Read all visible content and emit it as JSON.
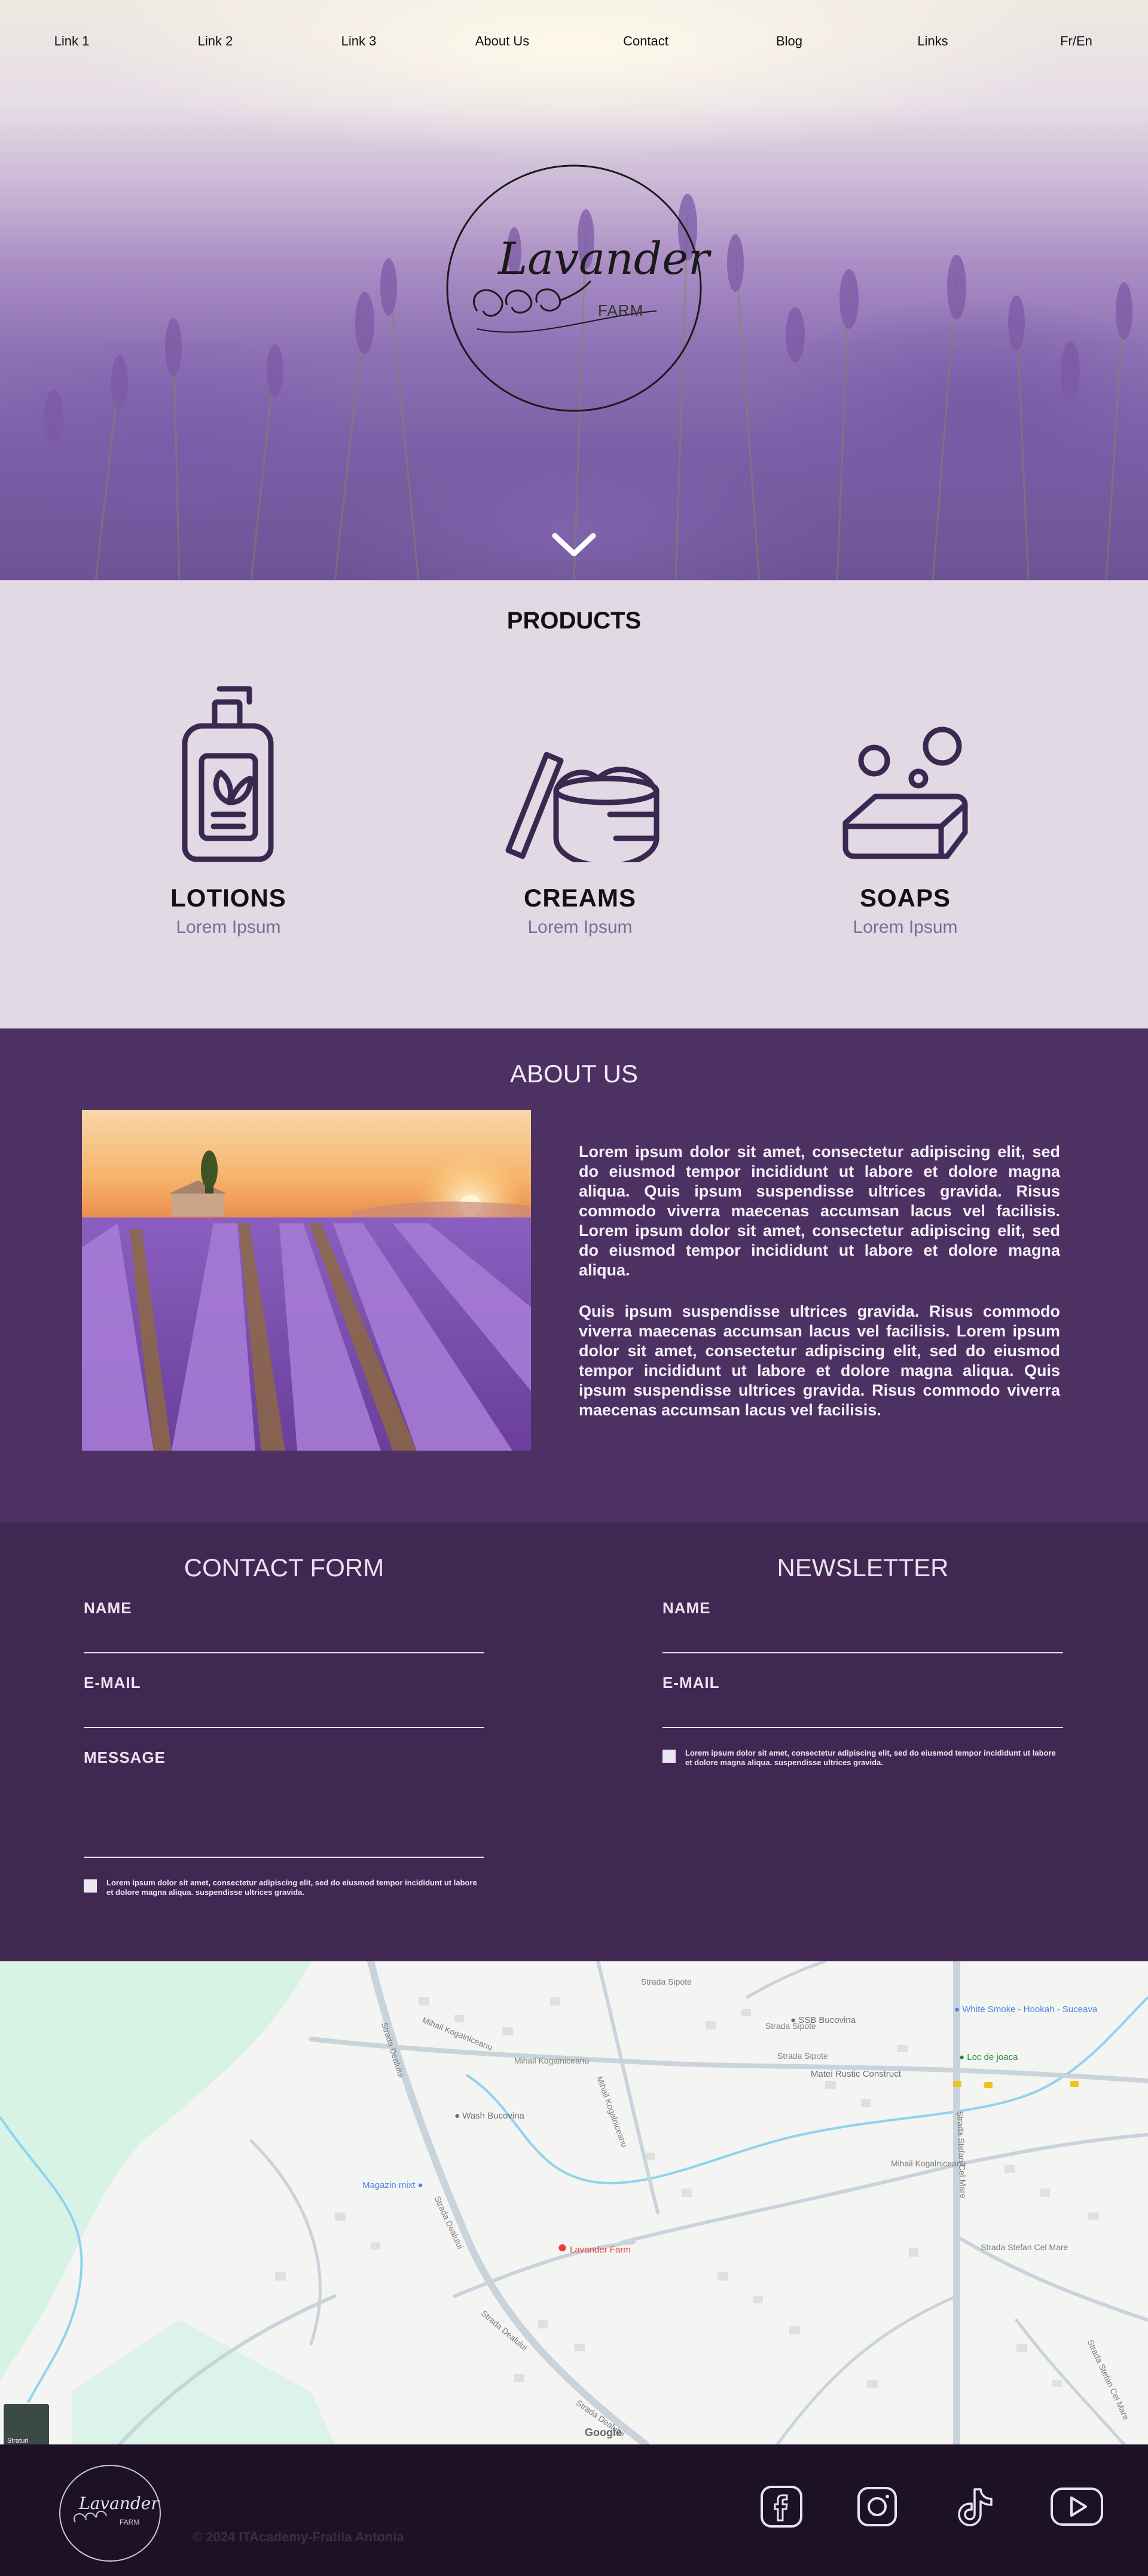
{
  "nav": {
    "items": [
      {
        "label": "Link 1"
      },
      {
        "label": "Link 2"
      },
      {
        "label": "Link 3"
      },
      {
        "label": "About Us"
      },
      {
        "label": "Contact"
      },
      {
        "label": "Blog"
      },
      {
        "label": "Links"
      },
      {
        "label": "Fr/En"
      }
    ]
  },
  "hero": {
    "logo_title": "Lavander",
    "logo_subtitle": "FARM",
    "scroll_icon": "chevron-down-icon"
  },
  "products": {
    "title": "PRODUCTS",
    "items": [
      {
        "name": "LOTIONS",
        "subtitle": "Lorem Ipsum",
        "icon": "lotion-bottle-icon"
      },
      {
        "name": "CREAMS",
        "subtitle": "Lorem Ipsum",
        "icon": "cream-jar-icon"
      },
      {
        "name": "SOAPS",
        "subtitle": "Lorem Ipsum",
        "icon": "soap-bar-icon"
      }
    ]
  },
  "about": {
    "title": "ABOUT US",
    "paragraph1": "Lorem ipsum dolor sit amet, consectetur adipiscing elit, sed do eiusmod tempor incididunt ut labore et dolore magna aliqua. Quis ipsum suspendisse ultrices gravida. Risus commodo viverra maecenas accumsan lacus vel facilisis. Lorem ipsum dolor sit amet, consectetur adipiscing elit, sed do eiusmod tempor incididunt ut labore et dolore magna aliqua.",
    "paragraph2": "Quis ipsum suspendisse ultrices gravida. Risus commodo viverra maecenas accumsan lacus vel facilisis. Lorem ipsum dolor sit amet, consectetur adipiscing elit, sed do eiusmod tempor incididunt ut labore et dolore magna aliqua. Quis ipsum suspendisse ultrices gravida. Risus commodo viverra maecenas accumsan lacus vel facilisis."
  },
  "contact": {
    "title": "CONTACT FORM",
    "name_label": "NAME",
    "email_label": "E-MAIL",
    "message_label": "MESSAGE",
    "consent": "Lorem ipsum dolor sit amet, consectetur adipiscing elit, sed do eiusmod tempor incididunt ut labore et dolore magna aliqua. suspendisse ultrices gravida."
  },
  "newsletter": {
    "title": "NEWSLETTER",
    "name_label": "NAME",
    "email_label": "E-MAIL",
    "consent": "Lorem ipsum dolor sit amet, consectetur adipiscing elit, sed do eiusmod tempor incididunt ut labore et dolore magna aliqua. suspendisse ultrices gravida."
  },
  "map": {
    "streets": [
      "Strada Sipote",
      "Strada Sipote",
      "Strada Dealului",
      "Mihail Kogalniceanu",
      "Mihail Kogalniceanu",
      "Mihail Kogalniceanu",
      "Mihail Kogalniceanu",
      "Strada Stefan Cel Mare",
      "Strada Stefan Cel Mare",
      "Strada Dealului",
      "Strada Dealului",
      "Strada Dealului",
      "Strada Stefan Cel Mare",
      "Strada Sipote"
    ],
    "places": {
      "ssb": "SSB Bucovina",
      "matei": "Matei Rustic Construct",
      "white_smoke": "White Smoke - Hookah - Suceava",
      "loc_joaca": "Loc de joaca",
      "wash": "Wash Bucovina",
      "magazin": "Magazin mixt",
      "farm": "Lavander Farm"
    },
    "google": "Google",
    "layers_label": "Straturi",
    "colors": {
      "water": "#8fd3ec",
      "park": "#d6f3e6",
      "road": "#c9d3dc",
      "pin": "#e3413a"
    }
  },
  "footer": {
    "logo_title": "Lavander",
    "logo_subtitle": "FARM",
    "copyright": "© 2024 ITAcademy-Fratila Antonia",
    "social": [
      {
        "icon": "facebook-icon"
      },
      {
        "icon": "instagram-icon"
      },
      {
        "icon": "tiktok-icon"
      },
      {
        "icon": "youtube-icon"
      }
    ]
  },
  "colors": {
    "products_bg": "#e1d9e4",
    "about_bg": "#4e3163",
    "forms_bg": "#412852",
    "footer_bg": "#1d1225",
    "icon_stroke": "#3b2850"
  }
}
